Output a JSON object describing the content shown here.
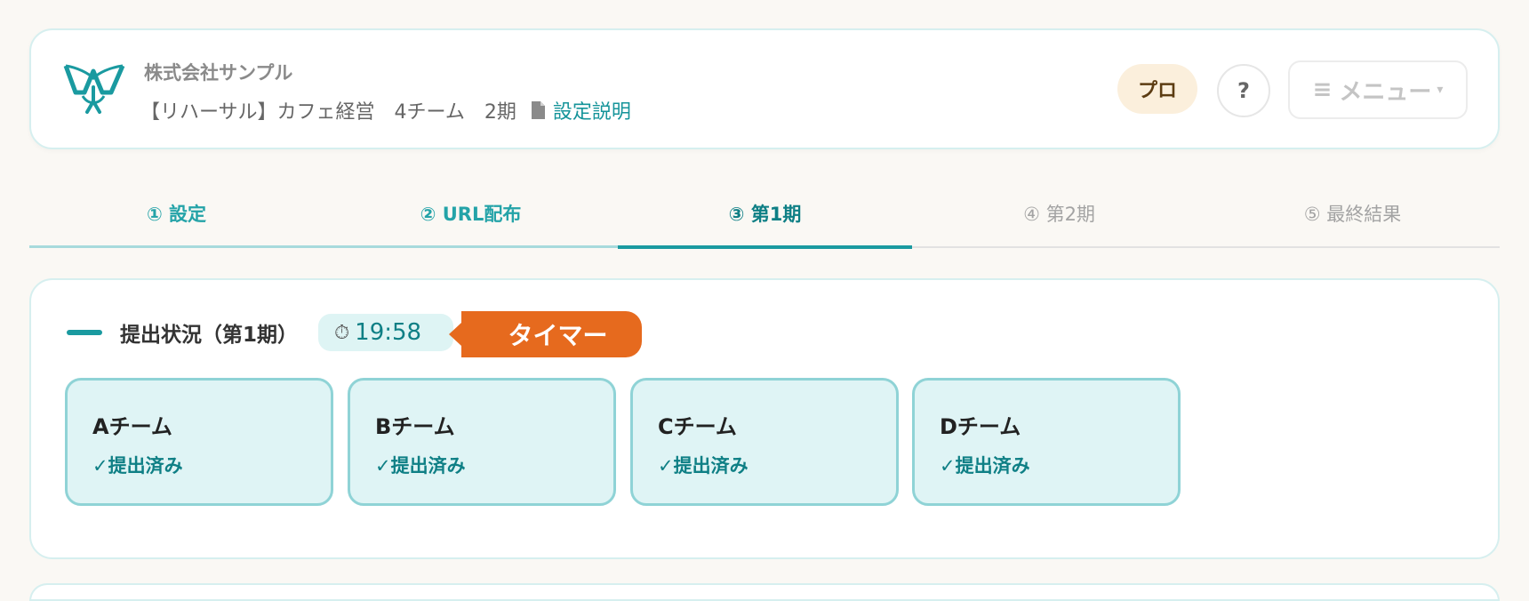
{
  "header": {
    "company": "株式会社サンプル",
    "event_title": "【リハーサル】カフェ経営　4チーム　2期",
    "doc_link": "設定説明",
    "plan_badge": "プロ",
    "help_label": "?",
    "menu_label": "メニュー",
    "menu_burger": "≡",
    "menu_caret": "▾"
  },
  "tabs": [
    {
      "label": "① 設定",
      "state": "done"
    },
    {
      "label": "② URL配布",
      "state": "done"
    },
    {
      "label": "③ 第1期",
      "state": "active"
    },
    {
      "label": "④ 第2期",
      "state": "todo"
    },
    {
      "label": "⑤ 最終結果",
      "state": "todo"
    }
  ],
  "submission": {
    "title": "提出状況（第1期）",
    "timer_icon": "⏱",
    "timer_value": "19:58",
    "timer_tag": "タイマー",
    "teams": [
      {
        "name": "Aチーム",
        "status": "✓提出済み"
      },
      {
        "name": "Bチーム",
        "status": "✓提出済み"
      },
      {
        "name": "Cチーム",
        "status": "✓提出済み"
      },
      {
        "name": "Dチーム",
        "status": "✓提出済み"
      }
    ]
  },
  "colors": {
    "accent": "#1a9aa0",
    "timer_tag": "#e66a1e",
    "card_bg": "#dff4f5",
    "pro_badge_bg": "#fbefdc"
  }
}
